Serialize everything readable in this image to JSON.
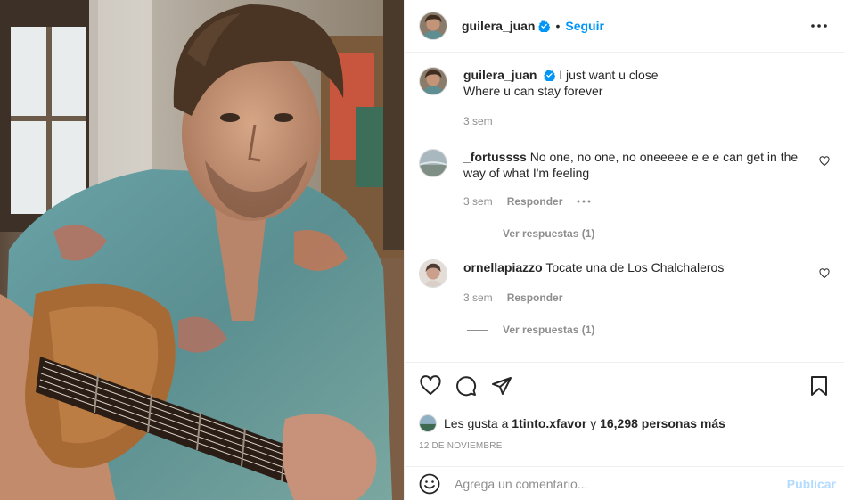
{
  "post": {
    "username": "guilera_juan",
    "follow_label": "Seguir",
    "separator": "•"
  },
  "caption": {
    "username": "guilera_juan",
    "line1": "I just want u close",
    "line2": "Where u can stay forever",
    "time": "3 sem"
  },
  "comments": [
    {
      "username": "_fortussss",
      "text": "No one, no one, no oneeeee e e e can get in the way of what I'm feeling",
      "time": "3 sem",
      "reply_label": "Responder",
      "view_replies": "Ver respuestas (1)"
    },
    {
      "username": "ornellapiazzo",
      "text": "Tocate una de Los Chalchaleros",
      "time": "3 sem",
      "reply_label": "Responder",
      "view_replies": "Ver respuestas (1)"
    }
  ],
  "likes": {
    "prefix": "Les gusta a",
    "liker": "1tinto.xfavor",
    "middle": "y",
    "count_text": "16,298 personas más"
  },
  "date": "12 de noviembre",
  "add_comment": {
    "placeholder": "Agrega un comentario...",
    "publish_label": "Publicar"
  },
  "icons": {
    "verified": "verified-badge-icon",
    "more": "more-options-icon",
    "like": "heart-icon",
    "comment": "comment-icon",
    "share": "share-icon",
    "save": "bookmark-icon",
    "emoji": "emoji-icon"
  },
  "colors": {
    "accent": "#0095f6",
    "publish_disabled": "#b3dbff",
    "muted": "#8e8e8e",
    "text": "#262626"
  }
}
